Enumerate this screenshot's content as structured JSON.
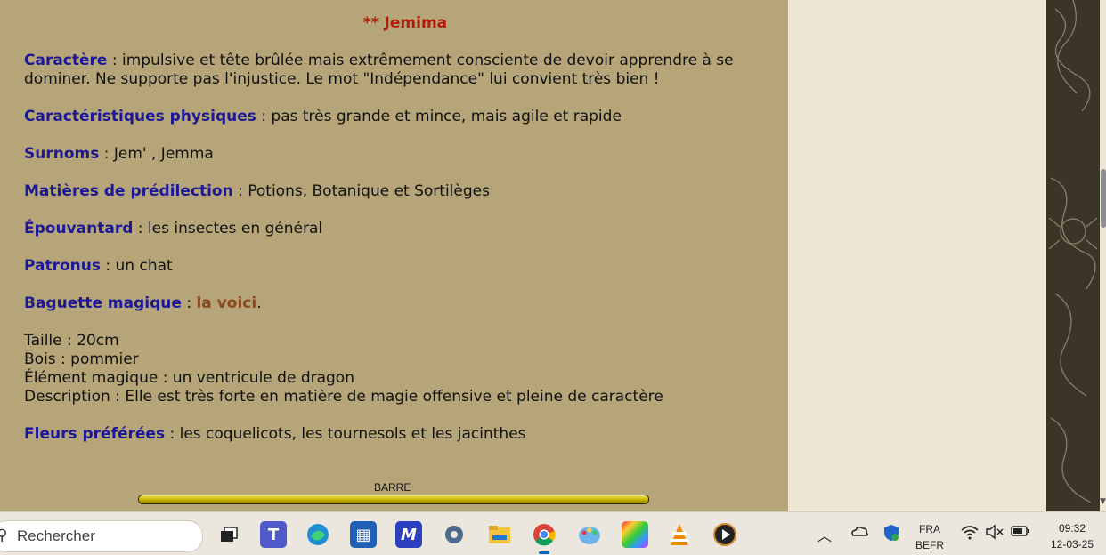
{
  "profile": {
    "title": "** Jemima",
    "caractere_label": "Caractère",
    "caractere_line1": " : impulsive et tête brûlée mais extrêmement consciente de devoir apprendre à se",
    "caractere_line2": "dominer. Ne supporte pas l'injustice. Le mot \"Indépendance\" lui convient très bien !",
    "physique_label": "Caractéristiques physiques",
    "physique_value": " : pas très grande et mince, mais agile et rapide",
    "surnoms_label": "Surnoms",
    "surnoms_value": " : Jem' , Jemma",
    "matieres_label": "Matières de prédilection",
    "matieres_value": " : Potions, Botanique et Sortilèges",
    "epouvantard_label": "Épouvantard",
    "epouvantard_value": " : les insectes en général",
    "patronus_label": "Patronus",
    "patronus_value": " : un chat",
    "baguette_label": "Baguette magique",
    "baguette_sep": " : ",
    "baguette_link": "la voici",
    "baguette_end": ".",
    "taille": "Taille : 20cm",
    "bois": "Bois : pommier",
    "element": "Élément magique : un ventricule de dragon",
    "description": "Description : Elle est très forte en matière de magie offensive et pleine de caractère",
    "fleurs_label": "Fleurs préférées",
    "fleurs_value": " : les coquelicots, les tournesols et les jacinthes",
    "barre_label": "BARRE"
  },
  "taskbar": {
    "search_placeholder": "Rechercher",
    "lang_top": "FRA",
    "lang_bottom": "BEFR",
    "time": "09:32",
    "date": "12-03-25"
  },
  "icons": {
    "search": "search-icon",
    "apps": [
      "task-view-icon",
      "teams-icon",
      "edge-icon",
      "store-icon",
      "mail-app-icon",
      "settings-icon",
      "file-explorer-icon",
      "chrome-icon",
      "paint-icon",
      "video-editor-icon",
      "vlc-icon",
      "media-player-icon"
    ],
    "tray": [
      "chevron-up-icon",
      "onedrive-icon",
      "defender-icon",
      "wifi-icon",
      "volume-muted-icon",
      "battery-icon"
    ]
  },
  "colors": {
    "content_bg": "#b5a578",
    "label": "#1d1895",
    "title": "#b31e0b",
    "link": "#8a4a1f"
  }
}
